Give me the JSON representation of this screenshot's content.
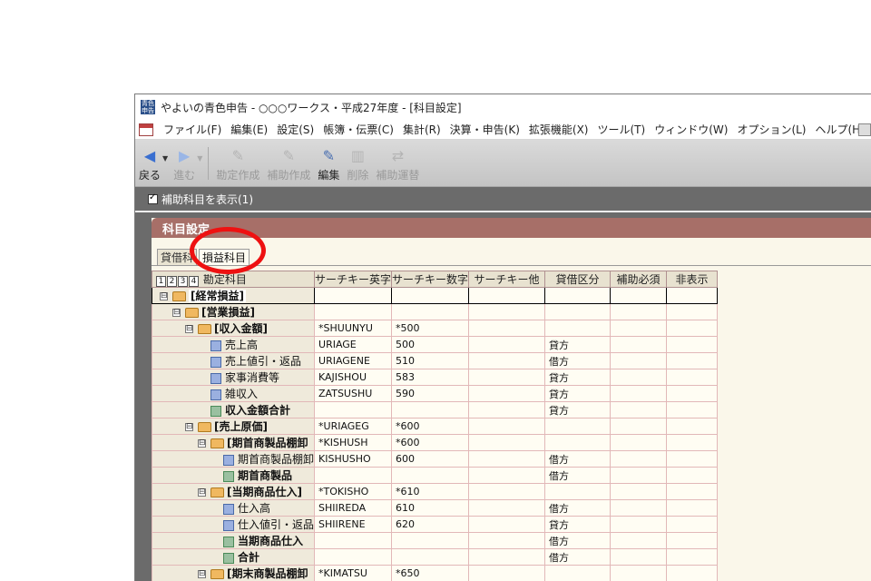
{
  "window": {
    "title": "やよいの青色申告 - ○○○ワークス・平成27年度 - [科目設定]"
  },
  "menu": [
    "ファイル(F)",
    "編集(E)",
    "設定(S)",
    "帳簿・伝票(C)",
    "集計(R)",
    "決算・申告(K)",
    "拡張機能(X)",
    "ツール(T)",
    "ウィンドウ(W)",
    "オプション(L)",
    "ヘルプ(H)"
  ],
  "toolbar": {
    "back": "戻る",
    "forward": "進む",
    "create_account": "勘定作成",
    "create_sub": "補助作成",
    "edit": "編集",
    "delete": "削除",
    "sub_switch": "補助運替"
  },
  "options": {
    "show_sub_accounts": "補助科目を表示(1)"
  },
  "panel": {
    "title": "科目設定"
  },
  "tabs": {
    "bs": "貸借科",
    "pl": "損益科目"
  },
  "grid": {
    "levels": [
      "1",
      "2",
      "3",
      "4"
    ],
    "name_header": "勘定科目",
    "headers": [
      "サーチキー英字",
      "サーチキー数字",
      "サーチキー他",
      "貸借区分",
      "補助必須",
      "非表示"
    ],
    "rows": [
      {
        "indent": 0,
        "toggle": "⊟",
        "icon": "folder",
        "name": "[経常損益]",
        "bold": true,
        "selected": true,
        "cells": [
          "",
          "",
          "",
          "",
          "",
          ""
        ]
      },
      {
        "indent": 1,
        "toggle": "⊟",
        "icon": "folder",
        "name": "[営業損益]",
        "bold": true,
        "cells": [
          "",
          "",
          "",
          "",
          "",
          ""
        ]
      },
      {
        "indent": 2,
        "toggle": "⊟",
        "icon": "folder",
        "name": "[収入金額]",
        "bold": true,
        "cells": [
          "*SHUUNYU",
          "*500",
          "",
          "",
          "",
          ""
        ]
      },
      {
        "indent": 3,
        "icon": "doc",
        "name": "売上高",
        "cells": [
          "URIAGE",
          "500",
          "",
          "貸方",
          "",
          ""
        ]
      },
      {
        "indent": 3,
        "icon": "doc",
        "name": "売上値引・返品",
        "cells": [
          "URIAGENE",
          "510",
          "",
          "借方",
          "",
          ""
        ]
      },
      {
        "indent": 3,
        "icon": "doc",
        "name": "家事消費等",
        "cells": [
          "KAJISHOU",
          "583",
          "",
          "貸方",
          "",
          ""
        ]
      },
      {
        "indent": 3,
        "icon": "doc",
        "name": "雑収入",
        "cells": [
          "ZATSUSHU",
          "590",
          "",
          "貸方",
          "",
          ""
        ]
      },
      {
        "indent": 3,
        "icon": "sum",
        "name": "収入金額合計",
        "bold": true,
        "cells": [
          "",
          "",
          "",
          "貸方",
          "",
          ""
        ]
      },
      {
        "indent": 2,
        "toggle": "⊟",
        "icon": "folder",
        "name": "[売上原価]",
        "bold": true,
        "cells": [
          "*URIAGEG",
          "*600",
          "",
          "",
          "",
          ""
        ]
      },
      {
        "indent": 3,
        "toggle": "⊟",
        "icon": "folder",
        "name": "[期首商製品棚卸",
        "bold": true,
        "cells": [
          "*KISHUSH",
          "*600",
          "",
          "",
          "",
          ""
        ]
      },
      {
        "indent": 4,
        "icon": "doc",
        "name": "期首商製品棚卸",
        "cells": [
          "KISHUSHO",
          "600",
          "",
          "借方",
          "",
          ""
        ]
      },
      {
        "indent": 4,
        "icon": "sum",
        "name": "期首商製品",
        "bold": true,
        "cells": [
          "",
          "",
          "",
          "借方",
          "",
          ""
        ]
      },
      {
        "indent": 3,
        "toggle": "⊟",
        "icon": "folder",
        "name": "[当期商品仕入]",
        "bold": true,
        "cells": [
          "*TOKISHO",
          "*610",
          "",
          "",
          "",
          ""
        ]
      },
      {
        "indent": 4,
        "icon": "doc",
        "name": "仕入高",
        "cells": [
          "SHIIREDA",
          "610",
          "",
          "借方",
          "",
          ""
        ]
      },
      {
        "indent": 4,
        "icon": "doc",
        "name": "仕入値引・返品",
        "cells": [
          "SHIIRENE",
          "620",
          "",
          "貸方",
          "",
          ""
        ]
      },
      {
        "indent": 4,
        "icon": "sum",
        "name": "当期商品仕入",
        "bold": true,
        "cells": [
          "",
          "",
          "",
          "借方",
          "",
          ""
        ]
      },
      {
        "indent": 4,
        "icon": "sum",
        "name": "合計",
        "bold": true,
        "cells": [
          "",
          "",
          "",
          "借方",
          "",
          ""
        ]
      },
      {
        "indent": 3,
        "toggle": "⊟",
        "icon": "folder",
        "name": "[期末商製品棚卸",
        "bold": true,
        "cells": [
          "*KIMATSU",
          "*650",
          "",
          "",
          "",
          ""
        ]
      }
    ]
  }
}
